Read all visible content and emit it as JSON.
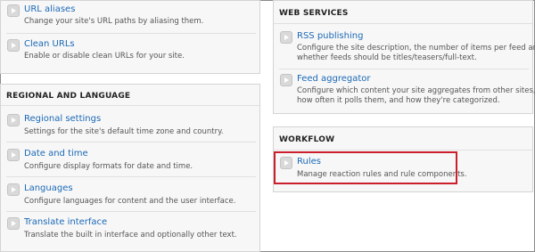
{
  "url_group": {
    "items": [
      {
        "title": "URL aliases",
        "desc": "Change your site's URL paths by aliasing them."
      },
      {
        "title": "Clean URLs",
        "desc": "Enable or disable clean URLs for your site."
      }
    ]
  },
  "regional": {
    "title": "REGIONAL AND LANGUAGE",
    "items": [
      {
        "title": "Regional settings",
        "desc": "Settings for the site's default time zone and country."
      },
      {
        "title": "Date and time",
        "desc": "Configure display formats for date and time."
      },
      {
        "title": "Languages",
        "desc": "Configure languages for content and the user interface."
      },
      {
        "title": "Translate interface",
        "desc": "Translate the built in interface and optionally other text."
      }
    ]
  },
  "web_services": {
    "title": "WEB SERVICES",
    "items": [
      {
        "title": "RSS publishing",
        "desc_line1": "Configure the site description, the number of items per feed and",
        "desc_line2": "whether feeds should be titles/teasers/full-text."
      },
      {
        "title": "Feed aggregator",
        "desc_line1": "Configure which content your site aggregates from other sites,",
        "desc_line2": "how often it polls them, and how they're categorized."
      }
    ]
  },
  "workflow": {
    "title": "WORKFLOW",
    "items": [
      {
        "title": "Rules",
        "desc": "Manage reaction rules and rule components."
      }
    ]
  },
  "colors": {
    "link": "#1b69b6",
    "highlight": "#cc1f2e"
  }
}
